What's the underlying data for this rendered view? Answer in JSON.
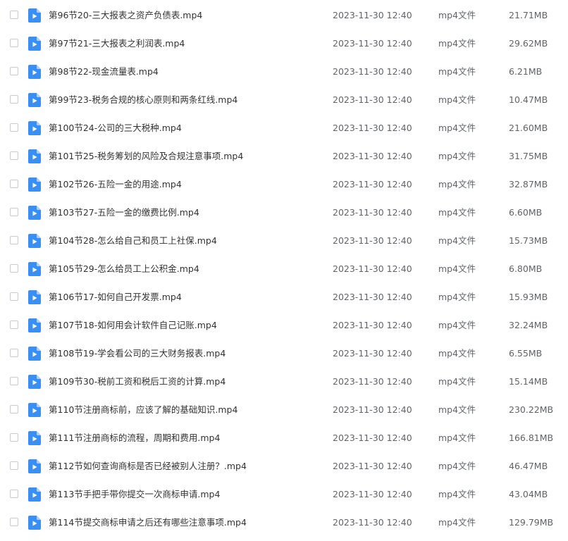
{
  "colors": {
    "video_icon": "#3a8ff5",
    "video_icon_fold": "#a9cdfb",
    "text_primary": "#333333",
    "text_secondary": "#5f6368",
    "checkbox_border": "#c8ccd2"
  },
  "icon_name": "video-file-icon",
  "files": [
    {
      "name": "第96节20-三大报表之资产负债表.mp4",
      "date": "2023-11-30 12:40",
      "type": "mp4文件",
      "size": "21.71MB"
    },
    {
      "name": "第97节21-三大报表之利润表.mp4",
      "date": "2023-11-30 12:40",
      "type": "mp4文件",
      "size": "29.62MB"
    },
    {
      "name": "第98节22-现金流量表.mp4",
      "date": "2023-11-30 12:40",
      "type": "mp4文件",
      "size": "6.21MB"
    },
    {
      "name": "第99节23-税务合规的核心原则和两条红线.mp4",
      "date": "2023-11-30 12:40",
      "type": "mp4文件",
      "size": "10.47MB"
    },
    {
      "name": "第100节24-公司的三大税种.mp4",
      "date": "2023-11-30 12:40",
      "type": "mp4文件",
      "size": "21.60MB"
    },
    {
      "name": "第101节25-税务筹划的风险及合规注意事项.mp4",
      "date": "2023-11-30 12:40",
      "type": "mp4文件",
      "size": "31.75MB"
    },
    {
      "name": "第102节26-五险一金的用途.mp4",
      "date": "2023-11-30 12:40",
      "type": "mp4文件",
      "size": "32.87MB"
    },
    {
      "name": "第103节27-五险一金的缴费比例.mp4",
      "date": "2023-11-30 12:40",
      "type": "mp4文件",
      "size": "6.60MB"
    },
    {
      "name": "第104节28-怎么给自己和员工上社保.mp4",
      "date": "2023-11-30 12:40",
      "type": "mp4文件",
      "size": "15.73MB"
    },
    {
      "name": "第105节29-怎么给员工上公积金.mp4",
      "date": "2023-11-30 12:40",
      "type": "mp4文件",
      "size": "6.80MB"
    },
    {
      "name": "第106节17-如何自己开发票.mp4",
      "date": "2023-11-30 12:40",
      "type": "mp4文件",
      "size": "15.93MB"
    },
    {
      "name": "第107节18-如何用会计软件自己记账.mp4",
      "date": "2023-11-30 12:40",
      "type": "mp4文件",
      "size": "32.24MB"
    },
    {
      "name": "第108节19-学会看公司的三大财务报表.mp4",
      "date": "2023-11-30 12:40",
      "type": "mp4文件",
      "size": "6.55MB"
    },
    {
      "name": "第109节30-税前工资和税后工资的计算.mp4",
      "date": "2023-11-30 12:40",
      "type": "mp4文件",
      "size": "15.14MB"
    },
    {
      "name": "第110节注册商标前，应该了解的基础知识.mp4",
      "date": "2023-11-30 12:40",
      "type": "mp4文件",
      "size": "230.22MB"
    },
    {
      "name": "第111节注册商标的流程，周期和费用.mp4",
      "date": "2023-11-30 12:40",
      "type": "mp4文件",
      "size": "166.81MB"
    },
    {
      "name": "第112节如何查询商标是否已经被别人注册？.mp4",
      "date": "2023-11-30 12:40",
      "type": "mp4文件",
      "size": "46.47MB"
    },
    {
      "name": "第113节手把手带你提交一次商标申请.mp4",
      "date": "2023-11-30 12:40",
      "type": "mp4文件",
      "size": "43.04MB"
    },
    {
      "name": "第114节提交商标申请之后还有哪些注意事项.mp4",
      "date": "2023-11-30 12:40",
      "type": "mp4文件",
      "size": "129.79MB"
    }
  ]
}
